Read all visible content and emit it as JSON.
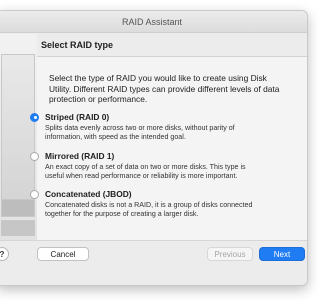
{
  "window": {
    "title": "RAID Assistant"
  },
  "header": {
    "title": "Select RAID type"
  },
  "intro": "Select the type of RAID you would like to create using Disk Utility. Different RAID types can provide different levels of data protection or performance.",
  "options": [
    {
      "label": "Striped (RAID 0)",
      "description": "Splits data evenly across two or more disks, without parity of information, with speed as the intended goal.",
      "selected": true
    },
    {
      "label": "Mirrored (RAID 1)",
      "description": "An exact copy of a set of data on two or more disks. This type is useful when read performance or reliability is more important.",
      "selected": false
    },
    {
      "label": "Concatenated (JBOD)",
      "description": "Concatenated disks is not a RAID, it is a group of disks connected together for the purpose of creating a larger disk.",
      "selected": false
    }
  ],
  "footer": {
    "help_label": "?",
    "cancel_label": "Cancel",
    "previous_label": "Previous",
    "next_label": "Next"
  },
  "colors": {
    "accent": "#1f7cf2"
  }
}
